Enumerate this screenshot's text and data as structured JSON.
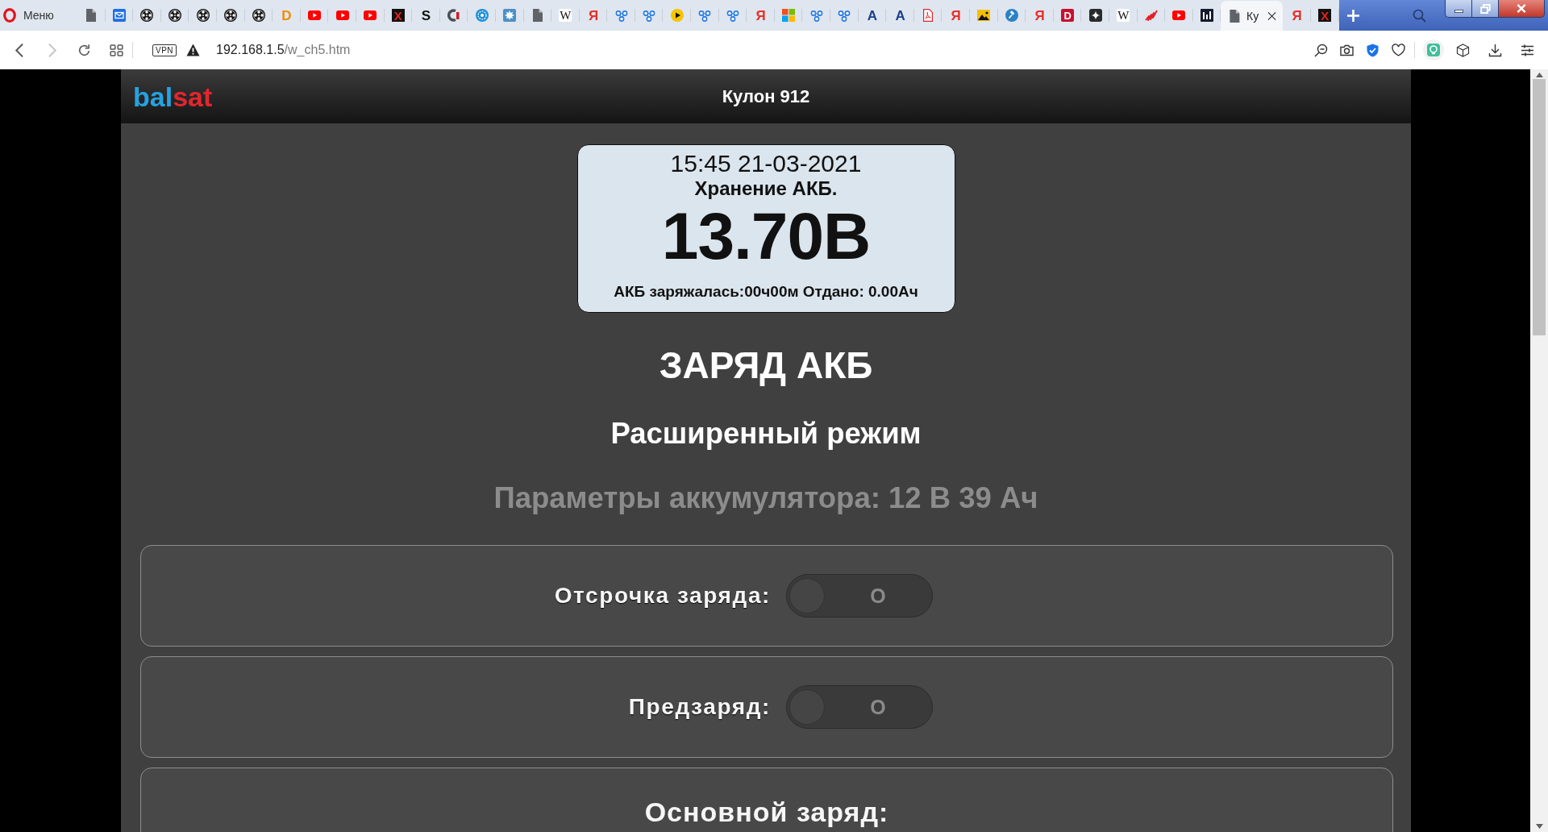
{
  "browser": {
    "menu_label": "Меню",
    "tabs": [
      {
        "kind": "document",
        "selected": false
      },
      {
        "kind": "mail",
        "selected": false
      },
      {
        "kind": "reel",
        "selected": false
      },
      {
        "kind": "reel",
        "selected": false
      },
      {
        "kind": "reel",
        "selected": false
      },
      {
        "kind": "reel",
        "selected": false
      },
      {
        "kind": "reel",
        "selected": false
      },
      {
        "kind": "letter",
        "glyph": "D",
        "color": "#f28c00",
        "selected": false
      },
      {
        "kind": "video",
        "selected": false
      },
      {
        "kind": "video",
        "selected": false
      },
      {
        "kind": "video",
        "selected": false
      },
      {
        "kind": "letter-dark",
        "glyph": "X",
        "selected": false
      },
      {
        "kind": "letter",
        "glyph": "S",
        "color": "#111111",
        "selected": false
      },
      {
        "kind": "arc",
        "selected": false
      },
      {
        "kind": "globe",
        "selected": false
      },
      {
        "kind": "splash-tile",
        "selected": false
      },
      {
        "kind": "document",
        "selected": false
      },
      {
        "kind": "letter-serif",
        "glyph": "W",
        "color": "#111111",
        "selected": false
      },
      {
        "kind": "letter",
        "glyph": "Я",
        "color": "#e8312a",
        "selected": false
      },
      {
        "kind": "dots",
        "selected": false
      },
      {
        "kind": "dots",
        "selected": false
      },
      {
        "kind": "play-circle",
        "selected": false
      },
      {
        "kind": "dots",
        "selected": false
      },
      {
        "kind": "dots",
        "selected": false
      },
      {
        "kind": "letter",
        "glyph": "Я",
        "color": "#e8312a",
        "selected": false
      },
      {
        "kind": "four-squares",
        "selected": false
      },
      {
        "kind": "dots",
        "selected": false
      },
      {
        "kind": "dots",
        "selected": false
      },
      {
        "kind": "letter",
        "glyph": "A",
        "color": "#1c3f8c",
        "selected": false
      },
      {
        "kind": "letter",
        "glyph": "A",
        "color": "#1c3f8c",
        "selected": false
      },
      {
        "kind": "pdf",
        "selected": false
      },
      {
        "kind": "letter",
        "glyph": "Я",
        "color": "#e8312a",
        "selected": false
      },
      {
        "kind": "image",
        "selected": false
      },
      {
        "kind": "gavel",
        "selected": false
      },
      {
        "kind": "letter",
        "glyph": "Я",
        "color": "#e8312a",
        "selected": false
      },
      {
        "kind": "letter-tile",
        "glyph": "D",
        "color": "#c8102e",
        "selected": false
      },
      {
        "kind": "sparkle-tile",
        "selected": false
      },
      {
        "kind": "letter-serif",
        "glyph": "W",
        "color": "#111111",
        "selected": false
      },
      {
        "kind": "scribble",
        "selected": false
      },
      {
        "kind": "video",
        "selected": false
      },
      {
        "kind": "bars",
        "selected": false
      },
      {
        "kind": "document",
        "title": "Ку",
        "selected": true
      },
      {
        "kind": "letter",
        "glyph": "Я",
        "color": "#e8312a",
        "selected": false
      },
      {
        "kind": "letter-dark",
        "glyph": "X",
        "selected": false
      }
    ],
    "nav": [
      {
        "kind": "back",
        "disabled": false
      },
      {
        "kind": "forward",
        "disabled": true
      },
      {
        "kind": "reload",
        "disabled": false
      },
      {
        "kind": "grid",
        "disabled": false
      }
    ],
    "vpn_label": "VPN",
    "url_host": "192.168.1.5",
    "url_path": "/w_ch5.htm"
  },
  "header": {
    "logo": [
      {
        "text": "bal",
        "color": "#27a2e0"
      },
      {
        "text": "sat",
        "color": "#e3262c"
      }
    ],
    "title": "Кулон 912"
  },
  "display": {
    "time": "15:45 21-03-2021",
    "mode": "Хранение АКБ.",
    "voltage": "13.70В",
    "stats": "АКБ заряжалась:00ч00м Отдано: 0.00Ач"
  },
  "page": {
    "title": "ЗАРЯД АКБ",
    "subtitle": "Расширенный режим",
    "battery_params": "Параметры аккумулятора: 12 В 39 Ач"
  },
  "cards": [
    {
      "kind": "switch",
      "label": "Отсрочка заряда:",
      "on": false,
      "state_text": "O"
    },
    {
      "kind": "switch",
      "label": "Предзаряд:",
      "on": false,
      "state_text": "O"
    },
    {
      "kind": "heading",
      "label": "Основной заряд:"
    }
  ]
}
